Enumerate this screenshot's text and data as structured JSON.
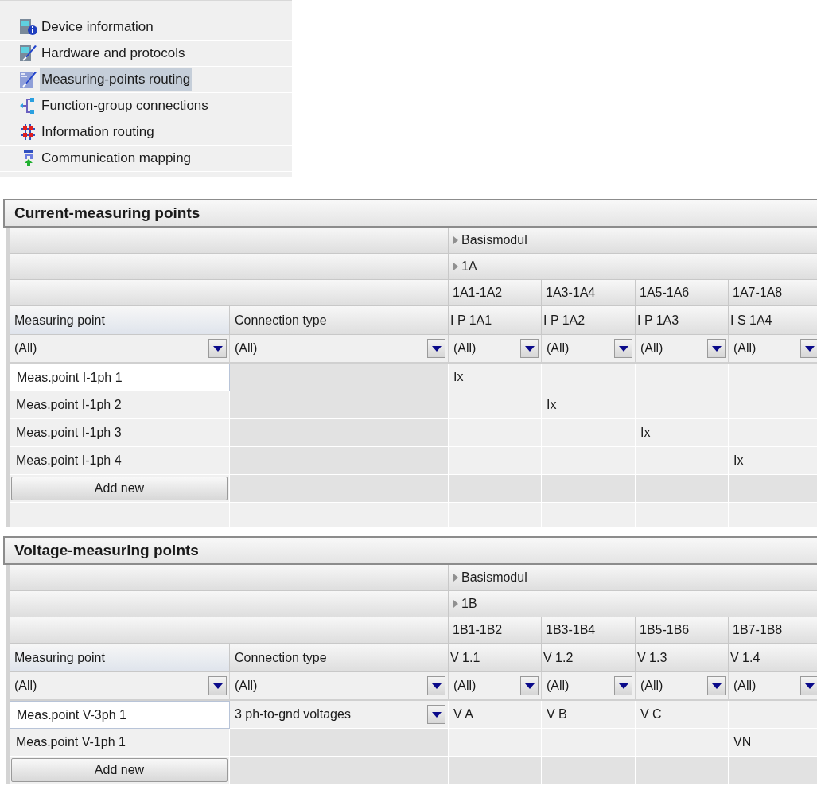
{
  "nav_items": [
    {
      "label": "Device information",
      "selected": false
    },
    {
      "label": "Hardware and protocols",
      "selected": false
    },
    {
      "label": "Measuring-points routing",
      "selected": true
    },
    {
      "label": "Function-group connections",
      "selected": false
    },
    {
      "label": "Information routing",
      "selected": false
    },
    {
      "label": "Communication mapping",
      "selected": false
    }
  ],
  "sections": [
    {
      "title": "Current-measuring points",
      "module": "Basismodul",
      "slot": "1A",
      "terminal_groups": [
        "1A1-1A2",
        "1A3-1A4",
        "1A5-1A6",
        "1A7-1A8"
      ],
      "columns": [
        "Measuring point",
        "Connection type"
      ],
      "channel_headers": [
        "I P 1A1",
        "I P 1A2",
        "I P 1A3",
        "I S 1A4"
      ],
      "filters": [
        "(All)",
        "(All)",
        "(All)",
        "(All)",
        "(All)",
        "(All)"
      ],
      "rows": [
        {
          "measuring_point": "Meas.point I-1ph 1",
          "selected": true,
          "cells": [
            {
              "kind": "assigned",
              "text": "Ix"
            },
            {
              "kind": "empty"
            },
            {
              "kind": "empty"
            },
            {
              "kind": "empty"
            }
          ]
        },
        {
          "measuring_point": "Meas.point I-1ph 2",
          "selected": false,
          "cells": [
            {
              "kind": "empty"
            },
            {
              "kind": "assigned",
              "text": "Ix"
            },
            {
              "kind": "empty"
            },
            {
              "kind": "empty"
            }
          ]
        },
        {
          "measuring_point": "Meas.point I-1ph 3",
          "selected": false,
          "cells": [
            {
              "kind": "empty"
            },
            {
              "kind": "empty"
            },
            {
              "kind": "assigned",
              "text": "Ix"
            },
            {
              "kind": "empty"
            }
          ]
        },
        {
          "measuring_point": "Meas.point I-1ph 4",
          "selected": false,
          "cells": [
            {
              "kind": "empty"
            },
            {
              "kind": "empty"
            },
            {
              "kind": "empty"
            },
            {
              "kind": "assigned",
              "text": "Ix"
            }
          ]
        }
      ],
      "add_button": "Add new"
    },
    {
      "title": "Voltage-measuring points",
      "module": "Basismodul",
      "slot": "1B",
      "terminal_groups": [
        "1B1-1B2",
        "1B3-1B4",
        "1B5-1B6",
        "1B7-1B8"
      ],
      "columns": [
        "Measuring point",
        "Connection type"
      ],
      "channel_headers": [
        "V 1.1",
        "V 1.2",
        "V 1.3",
        "V 1.4"
      ],
      "filters": [
        "(All)",
        "(All)",
        "(All)",
        "(All)",
        "(All)",
        "(All)"
      ],
      "rows": [
        {
          "measuring_point": "Meas.point V-3ph 1",
          "connection_type": "3 ph-to-gnd voltages",
          "selected": true,
          "cells": [
            {
              "kind": "assigned",
              "text": "V A"
            },
            {
              "kind": "assigned",
              "text": "V B"
            },
            {
              "kind": "assigned",
              "text": "V C"
            },
            {
              "kind": "empty"
            }
          ]
        },
        {
          "measuring_point": "Meas.point V-1ph 1",
          "selected": false,
          "cells": [
            {
              "kind": "empty"
            },
            {
              "kind": "empty"
            },
            {
              "kind": "empty"
            },
            {
              "kind": "assigned",
              "text": "VN"
            }
          ]
        }
      ],
      "add_button": "Add new"
    }
  ]
}
